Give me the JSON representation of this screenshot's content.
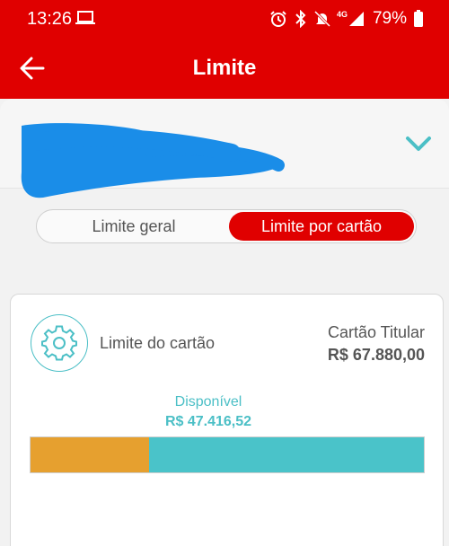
{
  "status_bar": {
    "time": "13:26",
    "network": "4G",
    "battery": "79%",
    "icons": [
      "laptop-icon",
      "alarm-icon",
      "bluetooth-icon",
      "muted-bell-icon",
      "signal-icon",
      "battery-icon"
    ]
  },
  "header": {
    "title": "Limite",
    "back_icon": "arrow-left-icon"
  },
  "account": {
    "name_redacted": true,
    "chevron_icon": "chevron-down-icon"
  },
  "toggle": {
    "options": [
      "Limite geral",
      "Limite por cartão"
    ],
    "selected": "Limite por cartão"
  },
  "card": {
    "icon": "gear-icon",
    "label": "Limite do cartão",
    "holder": "Cartão Titular",
    "total": "R$ 67.880,00",
    "available_label": "Disponível",
    "available_value": "R$ 47.416,52",
    "used_fraction": 0.302
  },
  "colors": {
    "brand_red": "#e00000",
    "accent_teal": "#4ac3c9",
    "used_orange": "#e6a02f",
    "redaction_blue": "#1a8de8"
  }
}
